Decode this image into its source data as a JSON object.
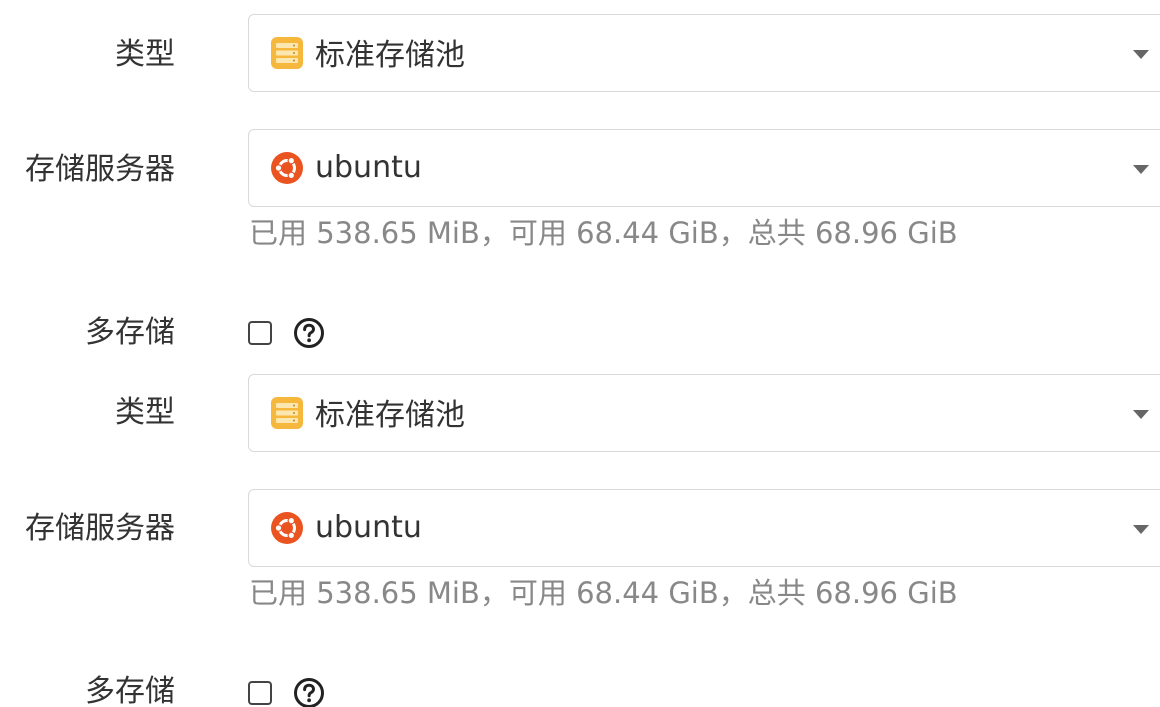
{
  "groups": [
    {
      "type_label": "类型",
      "type_value": "标准存储池",
      "type_icon": "storage-pool-icon",
      "server_label": "存储服务器",
      "server_value": "ubuntu",
      "server_icon": "ubuntu-icon",
      "usage_text": "已用 538.65 MiB，可用 68.44 GiB，总共 68.96 GiB",
      "multi_label": "多存储",
      "multi_checked": false,
      "help_icon": "question-circle-icon"
    },
    {
      "type_label": "类型",
      "type_value": "标准存储池",
      "type_icon": "storage-pool-icon",
      "server_label": "存储服务器",
      "server_value": "ubuntu",
      "server_icon": "ubuntu-icon",
      "usage_text": "已用 538.65 MiB，可用 68.44 GiB，总共 68.96 GiB",
      "multi_label": "多存储",
      "multi_checked": false,
      "help_icon": "question-circle-icon"
    }
  ],
  "colors": {
    "pool_icon": "#f5b83d",
    "ubuntu_icon": "#e95420",
    "border": "#d9d9d9",
    "hint_text": "#888888"
  }
}
